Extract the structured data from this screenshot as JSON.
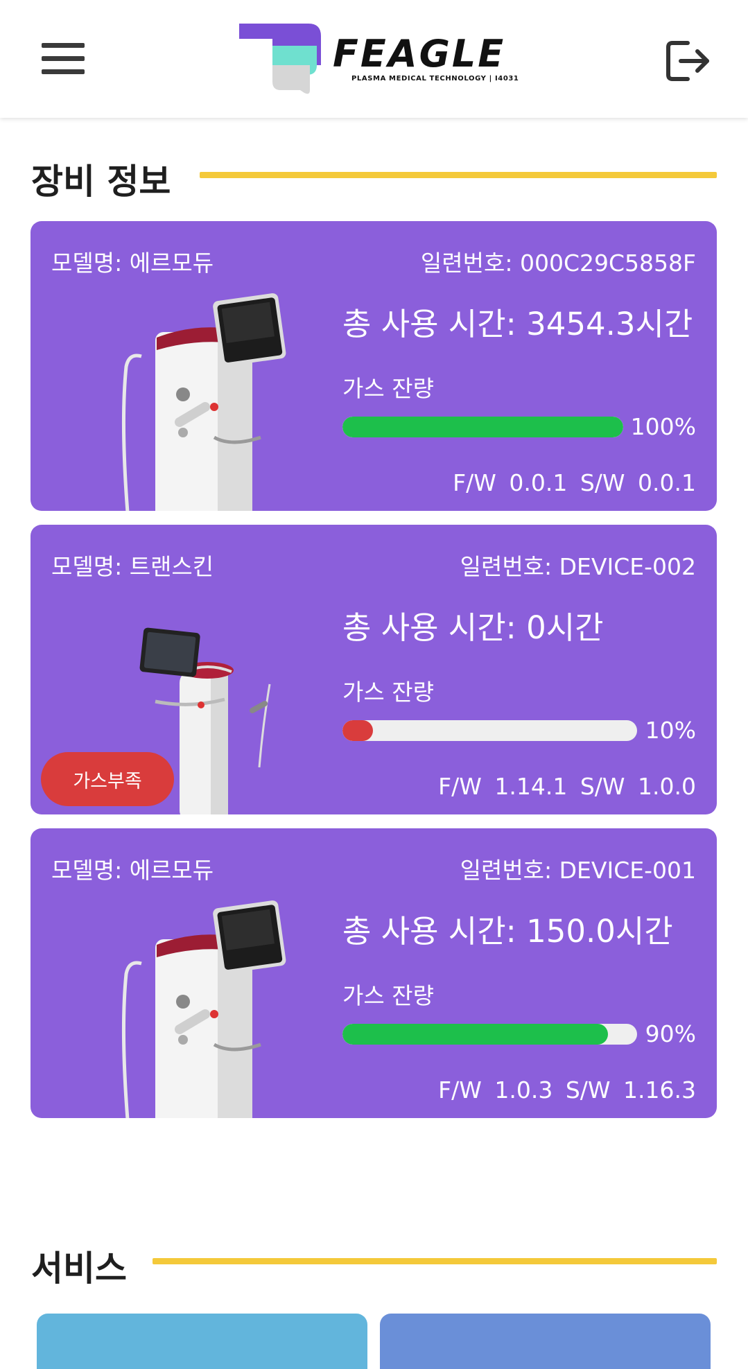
{
  "header": {
    "logo_text": "FEAGLE",
    "logo_subtitle": "PLASMA MEDICAL TECHNOLOGY | I4031"
  },
  "sections": {
    "equipment_title": "장비 정보",
    "service_title": "서비스"
  },
  "devices": [
    {
      "model": "모델명: 에르모듀",
      "serial": "일련번호: 000C29C5858F",
      "usage": "총 사용 시간: 3454.3시간",
      "gas_label": "가스 잔량",
      "gas_percent_text": "100%",
      "gas_fraction": 1.0,
      "bar_color": "#1dbf4b",
      "firmware": "F/W 0.0.1",
      "software": "S/W 0.0.1",
      "badge": ""
    },
    {
      "model": "모델명: 트랜스킨",
      "serial": "일련번호: DEVICE-002",
      "usage": "총 사용 시간: 0시간",
      "gas_label": "가스 잔량",
      "gas_percent_text": "10%",
      "gas_fraction": 0.1,
      "bar_color": "#d93c3c",
      "firmware": "F/W 1.14.1",
      "software": "S/W 1.0.0",
      "badge": "가스부족"
    },
    {
      "model": "모델명: 에르모듀",
      "serial": "일련번호: DEVICE-001",
      "usage": "총 사용 시간: 150.0시간",
      "gas_label": "가스 잔량",
      "gas_percent_text": "90%",
      "gas_fraction": 0.9,
      "bar_color": "#1dbf4b",
      "firmware": "F/W 1.0.3",
      "software": "S/W 1.16.3",
      "badge": ""
    }
  ],
  "colors": {
    "card": "#8b5fdb",
    "accent_line": "#f4c93a",
    "tile_left": "#62b5dc",
    "tile_right": "#6a8fd8"
  }
}
